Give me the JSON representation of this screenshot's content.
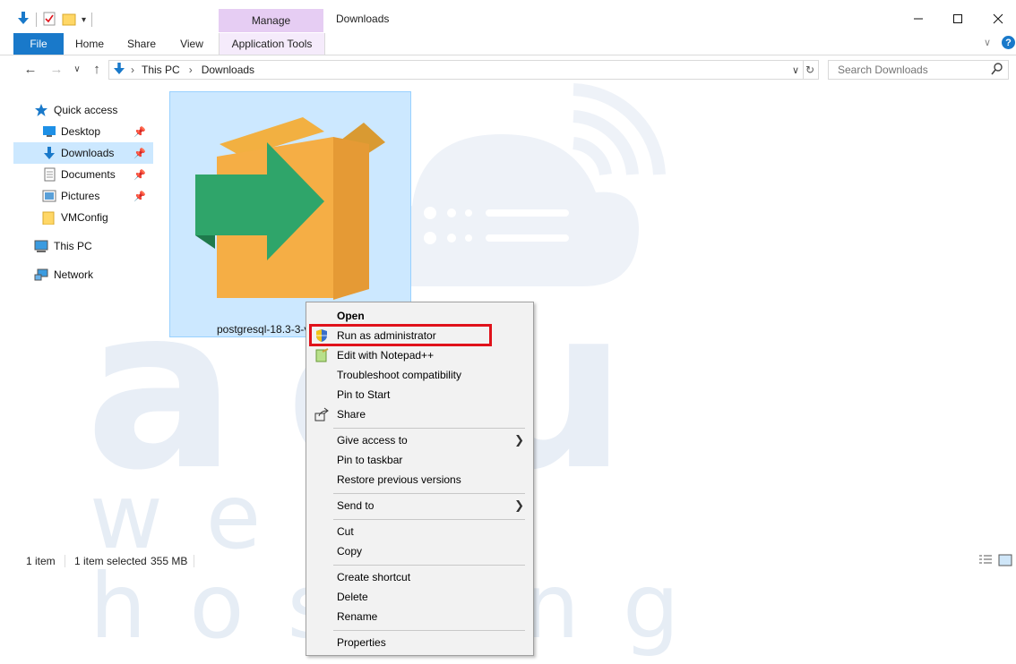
{
  "window": {
    "title": "Downloads"
  },
  "ribbon": {
    "context_group": "Manage",
    "tabs": [
      {
        "label": "File"
      },
      {
        "label": "Home"
      },
      {
        "label": "Share"
      },
      {
        "label": "View"
      },
      {
        "label": "Application Tools"
      }
    ]
  },
  "address": {
    "breadcrumbs": [
      "This PC",
      "Downloads"
    ],
    "search_placeholder": "Search Downloads"
  },
  "nav_pane": {
    "items": [
      {
        "label": "Quick access",
        "icon": "star-icon"
      },
      {
        "label": "Desktop",
        "icon": "desktop-icon",
        "pinned": true
      },
      {
        "label": "Downloads",
        "icon": "download-arrow-icon",
        "pinned": true,
        "selected": true
      },
      {
        "label": "Documents",
        "icon": "document-icon",
        "pinned": true
      },
      {
        "label": "Pictures",
        "icon": "pictures-icon",
        "pinned": true
      },
      {
        "label": "VMConfig",
        "icon": "folder-icon"
      },
      {
        "label": "This PC",
        "icon": "computer-icon"
      },
      {
        "label": "Network",
        "icon": "network-icon"
      }
    ]
  },
  "file": {
    "name": "postgresql-18.3-3-v",
    "icon": "installer-package-icon"
  },
  "status": {
    "count": "1 item",
    "selected": "1 item selected",
    "size": "355 MB"
  },
  "context_menu": {
    "items": [
      {
        "label": "Open",
        "bold": true
      },
      {
        "label": "Run as administrator",
        "icon": "uac-shield-icon",
        "highlighted": true
      },
      {
        "label": "Edit with Notepad++",
        "icon": "notepad-plus-icon"
      },
      {
        "label": "Troubleshoot compatibility"
      },
      {
        "label": "Pin to Start"
      },
      {
        "label": "Share",
        "icon": "share-icon"
      },
      {
        "label": "Give access to",
        "submenu": true
      },
      {
        "label": "Pin to taskbar"
      },
      {
        "label": "Restore previous versions"
      },
      {
        "label": "Send to",
        "submenu": true
      },
      {
        "label": "Cut"
      },
      {
        "label": "Copy"
      },
      {
        "label": "Create shortcut"
      },
      {
        "label": "Delete"
      },
      {
        "label": "Rename"
      },
      {
        "label": "Properties"
      }
    ]
  },
  "colors": {
    "accent": "#1979ca",
    "selection": "#cce8ff",
    "manage_tab": "#e6cdf3",
    "highlight_box": "#e0121b"
  },
  "watermark": {
    "line1": "acu",
    "line2": "web hosting"
  }
}
